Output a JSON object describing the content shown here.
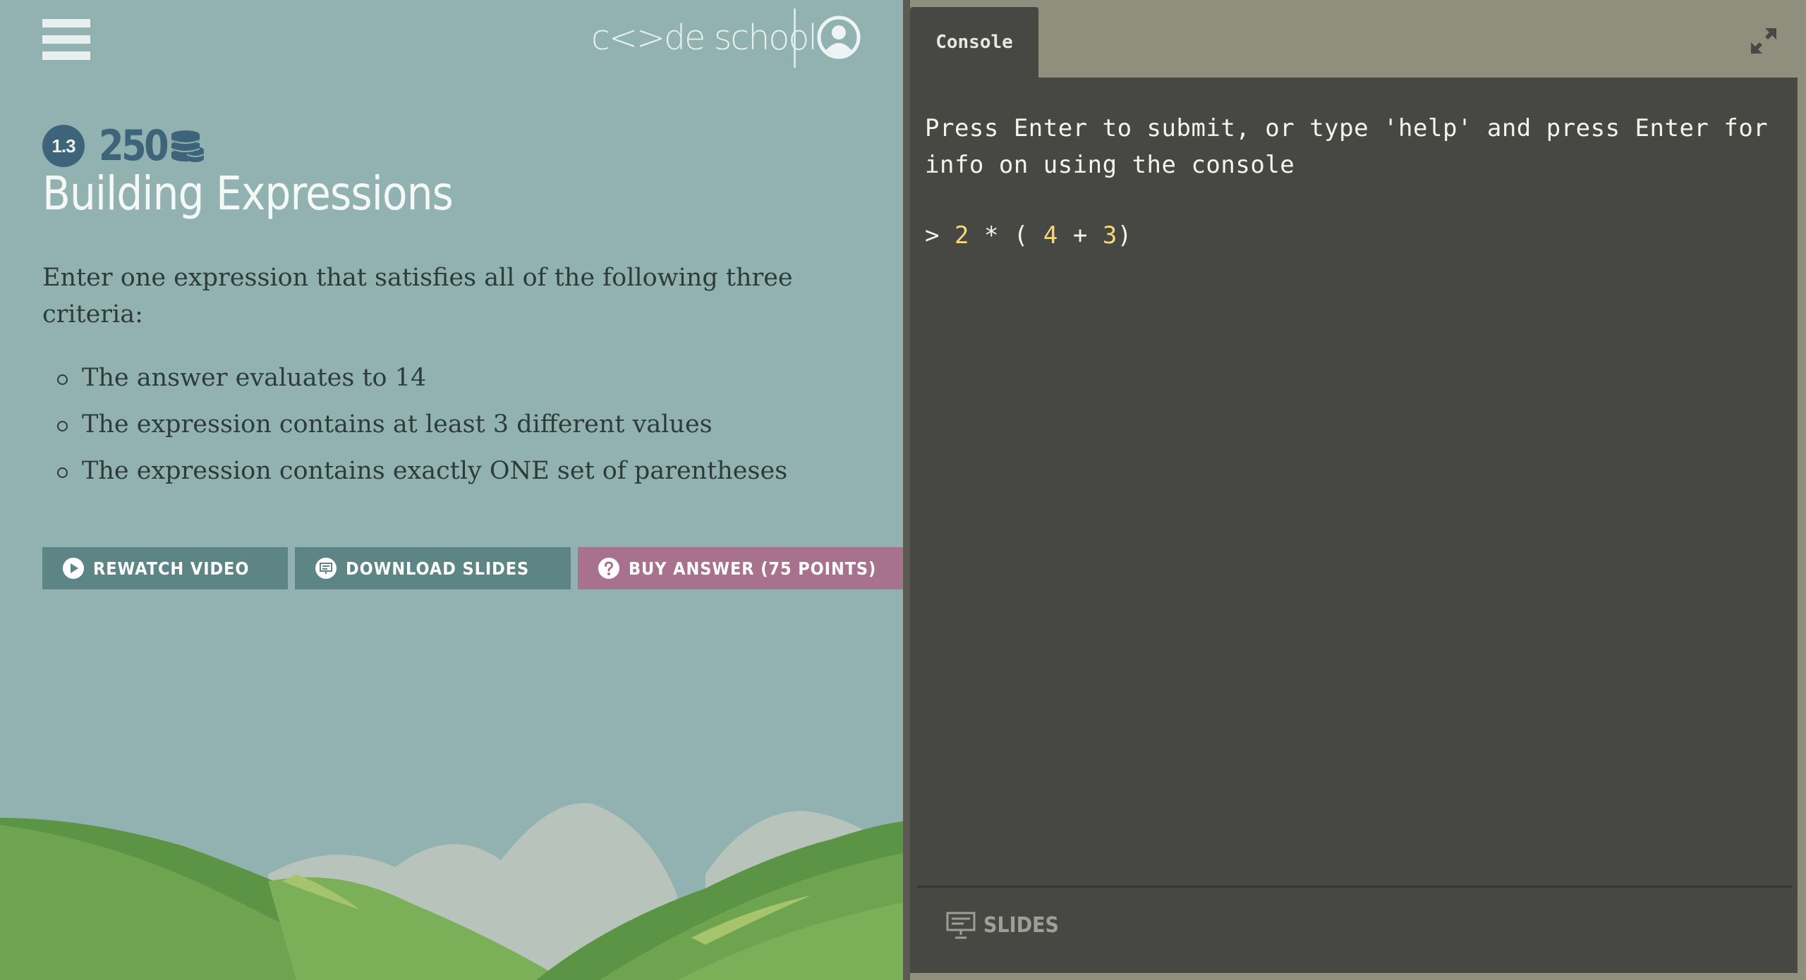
{
  "header": {
    "menu_icon": "hamburger-menu-icon",
    "logo_text": "c<>de school",
    "account_icon": "user-account-icon"
  },
  "challenge": {
    "level": "1.3",
    "points": "250",
    "points_icon": "coin-stack-icon",
    "title": "Building Expressions",
    "intro": "Enter one expression that satisfies all of the following three criteria:",
    "criteria": [
      "The answer evaluates to 14",
      "The expression contains at least 3 different values",
      "The expression contains exactly ONE set of parentheses"
    ]
  },
  "buttons": {
    "rewatch": "REWATCH VIDEO",
    "download": "DOWNLOAD SLIDES",
    "buy": "BUY ANSWER (75 POINTS)"
  },
  "console": {
    "tab_label": "Console",
    "expand_icon": "expand-arrows-icon",
    "help_text": "Press Enter to submit, or type 'help' and press Enter for info on using the console",
    "prompt": ">",
    "input_tokens": [
      {
        "text": "2",
        "kind": "num"
      },
      {
        "text": "*",
        "kind": "op"
      },
      {
        "text": "(",
        "kind": "op"
      },
      {
        "text": "4",
        "kind": "num"
      },
      {
        "text": "+",
        "kind": "op"
      },
      {
        "text": "3",
        "kind": "num"
      },
      {
        "text": ")",
        "kind": "op"
      }
    ],
    "slides_label": "SLIDES",
    "slides_icon": "presentation-icon"
  },
  "colors": {
    "left_bg": "#91b2b0",
    "accent_blue": "#3d6478",
    "button_gray": "#5d8585",
    "button_pink": "#a8728f",
    "console_bg": "#474743",
    "number_yellow": "#f3d97a"
  }
}
